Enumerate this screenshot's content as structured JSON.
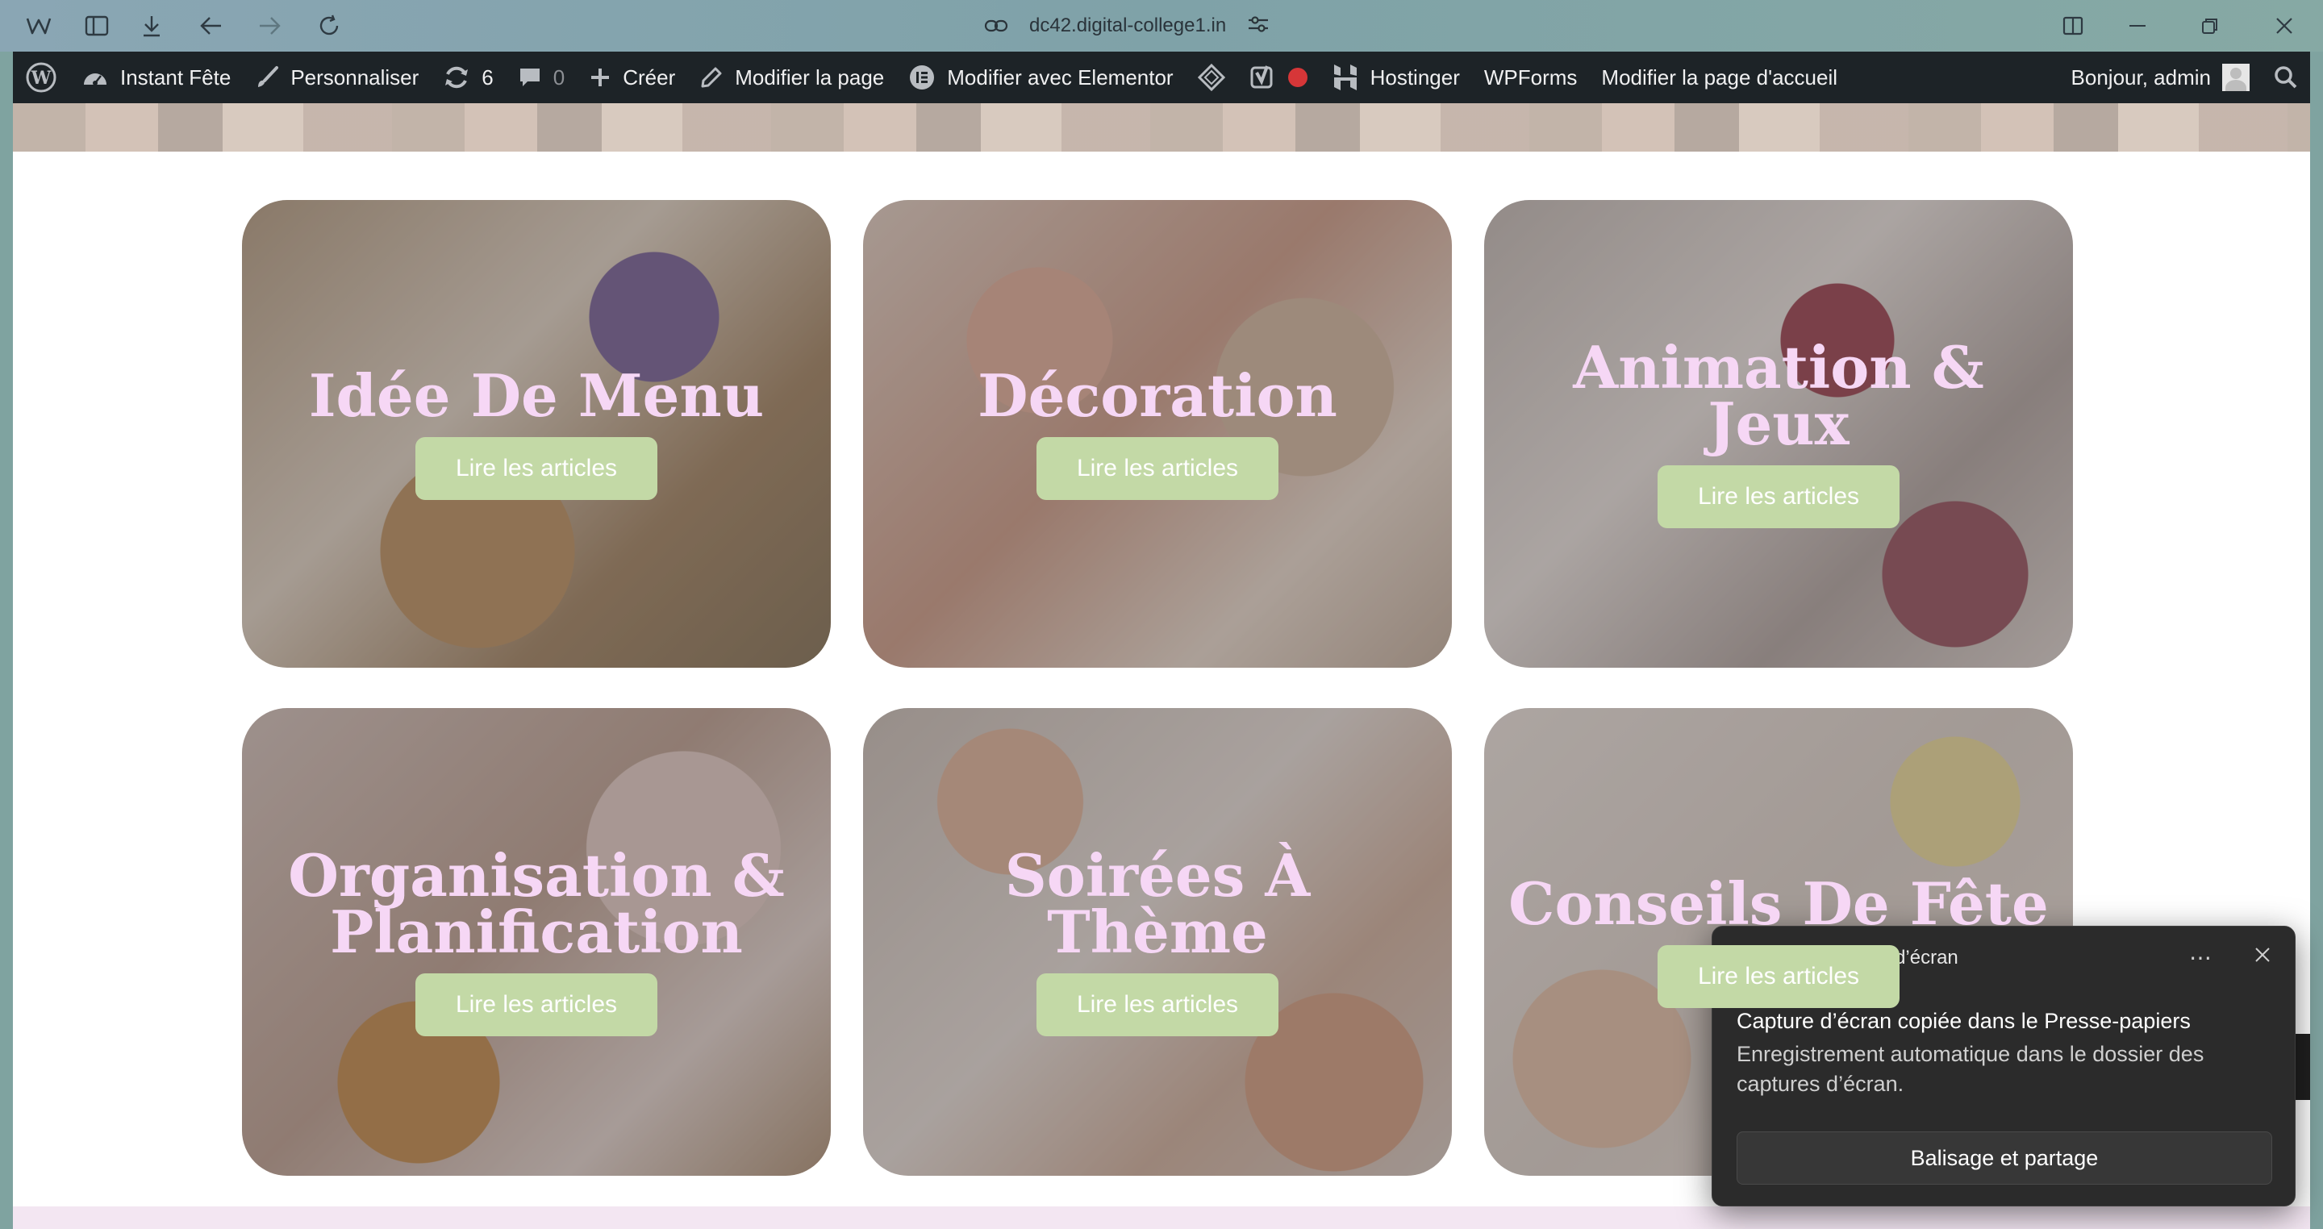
{
  "browser": {
    "url": "dc42.digital-college1.in"
  },
  "admin_bar": {
    "site_name": "Instant Fête",
    "customize": "Personnaliser",
    "updates_count": "6",
    "comments_count": "0",
    "new": "Créer",
    "edit_page": "Modifier la page",
    "edit_elementor": "Modifier avec Elementor",
    "hostinger": "Hostinger",
    "wpforms": "WPForms",
    "edit_home": "Modifier la page d'accueil",
    "greeting": "Bonjour, admin"
  },
  "cards": [
    {
      "title": "Idée De Menu",
      "button": "Lire les articles"
    },
    {
      "title": "Décoration",
      "button": "Lire les articles"
    },
    {
      "title": "Animation & Jeux",
      "button": "Lire les articles"
    },
    {
      "title": "Organisation & Planification",
      "button": "Lire les articles"
    },
    {
      "title": "Soirées À Thème",
      "button": "Lire les articles"
    },
    {
      "title": "Conseils De Fête",
      "button": "Lire les articles"
    }
  ],
  "toast": {
    "app_name": "Outil Capture d’écran",
    "title": "Capture d’écran copiée dans le Presse-papiers",
    "body": "Enregistrement automatique dans le dossier des captures d’écran.",
    "action": "Balisage et partage"
  },
  "colors": {
    "admin_bar_bg": "#1d2327",
    "card_title": "#f6d7f5",
    "button_bg": "#c3d9a6",
    "toast_bg": "#2b2b2b"
  }
}
